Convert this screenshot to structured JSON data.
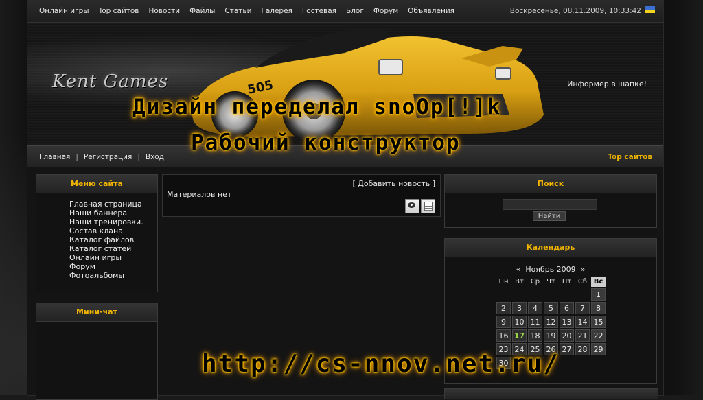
{
  "topnav": {
    "links": [
      "Онлайн игры",
      "Top сайтов",
      "Новости",
      "Файлы",
      "Статьи",
      "Галерея",
      "Гостевая",
      "Блог",
      "Форум",
      "Объявления"
    ],
    "datetime": "Воскресенье, 08.11.2009, 10:33:42"
  },
  "header": {
    "logo": "Kent Games",
    "informer": "Информер в шапке!"
  },
  "overlay": {
    "line1": "Дизайн переделал snoOp[!]k",
    "line2": "Рабочий конструктор",
    "url": "http://cs-nnov.net.ru/"
  },
  "subnav": {
    "links": [
      "Главная",
      "Регистрация",
      "Вход"
    ],
    "separator": "|",
    "top_sites": "Top сайтов"
  },
  "site_menu": {
    "title": "Меню сайта",
    "items": [
      "Главная страница",
      "Наши баннера",
      "Наши тренировки.",
      "Состав клана",
      "Каталог файлов",
      "Каталог статей",
      "Онлайн игры",
      "Форум",
      "Фотоальбомы"
    ]
  },
  "minichat": {
    "title": "Мини-чат"
  },
  "content": {
    "add_news": "Добавить новость",
    "bracket_open": "[",
    "bracket_close": "]",
    "no_materials": "Материалов нет",
    "icons": [
      "eye-icon",
      "document-icon"
    ]
  },
  "search": {
    "title": "Поиск",
    "value": "",
    "button": "Найти"
  },
  "calendar": {
    "title": "Календарь",
    "prev": "«",
    "next": "»",
    "month": "Ноябрь 2009",
    "weekdays": [
      "Пн",
      "Вт",
      "Ср",
      "Чт",
      "Пт",
      "Сб",
      "Вс"
    ],
    "weeks": [
      [
        "",
        "",
        "",
        "",
        "",
        "",
        "1"
      ],
      [
        "2",
        "3",
        "4",
        "5",
        "6",
        "7",
        "8"
      ],
      [
        "9",
        "10",
        "11",
        "12",
        "13",
        "14",
        "15"
      ],
      [
        "16",
        "17",
        "18",
        "19",
        "20",
        "21",
        "22"
      ],
      [
        "23",
        "24",
        "25",
        "26",
        "27",
        "28",
        "29"
      ],
      [
        "30",
        "",
        "",
        "",
        "",
        "",
        ""
      ]
    ],
    "today": "17"
  },
  "colors": {
    "accent": "#f0b400",
    "today": "#9bd64a",
    "glow": "#ffcc00"
  }
}
